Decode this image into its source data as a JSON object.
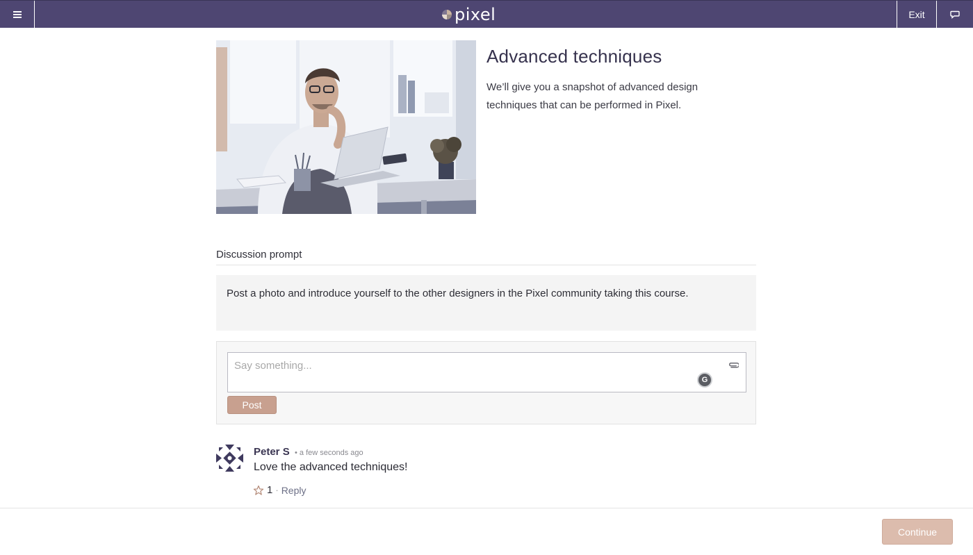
{
  "header": {
    "logo_text": "pixel",
    "exit_label": "Exit",
    "menu_icon": "hamburger-menu-icon",
    "chat_icon": "chat-bubble-icon",
    "bar_color": "#4e4672"
  },
  "lesson": {
    "title": "Advanced techniques",
    "description": "We’ll give you a snapshot of advanced design techniques that can be performed in Pixel."
  },
  "discussion": {
    "label": "Discussion prompt",
    "prompt": "Post a photo and introduce yourself to the other designers in the Pixel community taking this course."
  },
  "composer": {
    "placeholder": "Say something...",
    "value": "",
    "post_label": "Post",
    "attach_icon": "paperclip-icon",
    "grammar_icon": "grammarly-icon"
  },
  "comments": [
    {
      "author": "Peter S",
      "time": "• a few seconds ago",
      "text": "Love the advanced techniques!",
      "likes": "1",
      "reply_label": "Reply"
    }
  ],
  "footer": {
    "continue_label": "Continue",
    "accent_color": "#c8a08f"
  }
}
